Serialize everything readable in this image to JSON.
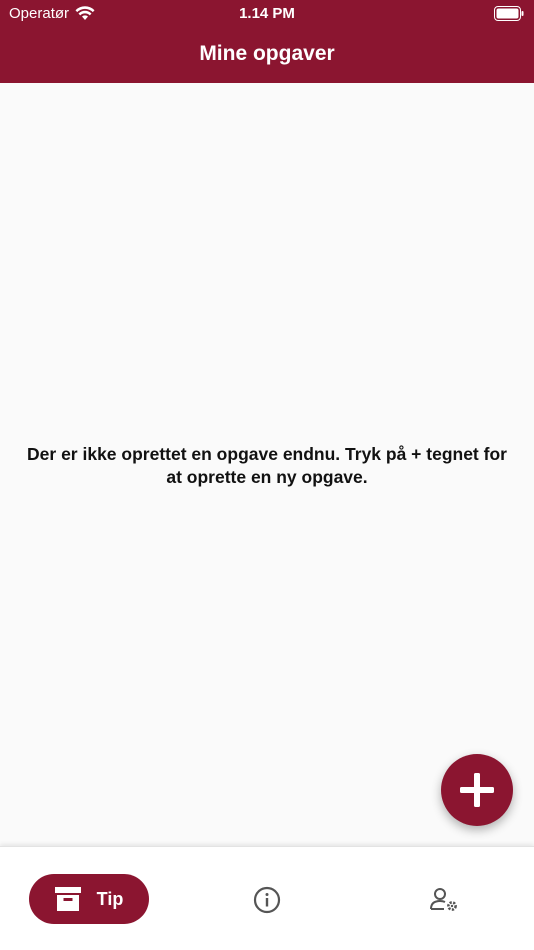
{
  "status_bar": {
    "carrier": "Operatør",
    "time": "1.14 PM"
  },
  "header": {
    "title": "Mine opgaver"
  },
  "main": {
    "empty_message": "Der er ikke oprettet en opgave endnu. Tryk på + tegnet for at oprette en ny opgave."
  },
  "tabs": [
    {
      "label": "Tip",
      "icon": "archive-box-icon",
      "active": true
    },
    {
      "label": "",
      "icon": "info-icon",
      "active": false
    },
    {
      "label": "",
      "icon": "user-settings-icon",
      "active": false
    }
  ],
  "colors": {
    "brand": "#8b1530",
    "background": "#fafafa",
    "icon_gray": "#555555"
  }
}
